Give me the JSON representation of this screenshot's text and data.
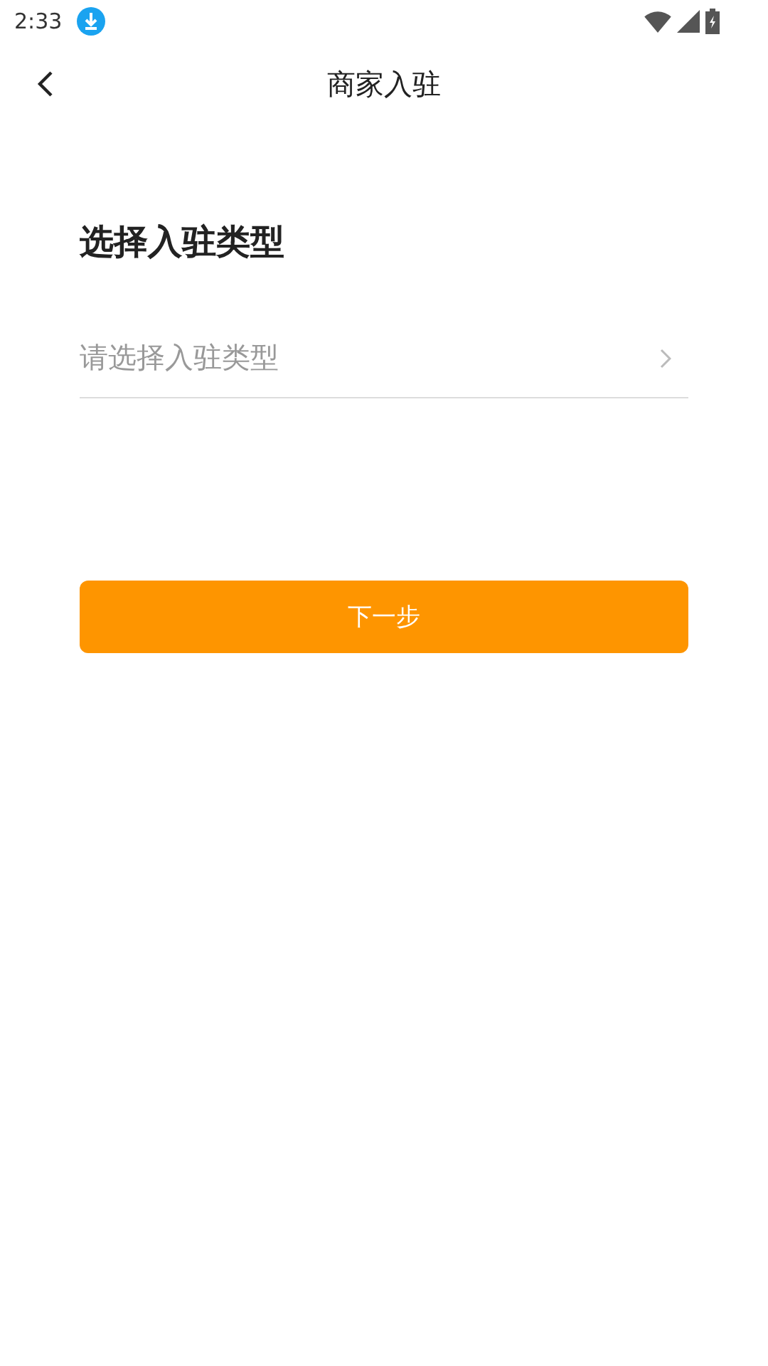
{
  "status_bar": {
    "time": "2:33"
  },
  "header": {
    "title": "商家入驻"
  },
  "form": {
    "heading": "选择入驻类型",
    "select": {
      "placeholder": "请选择入驻类型"
    }
  },
  "buttons": [
    {
      "label": "下一步",
      "kind": "primary"
    }
  ]
}
